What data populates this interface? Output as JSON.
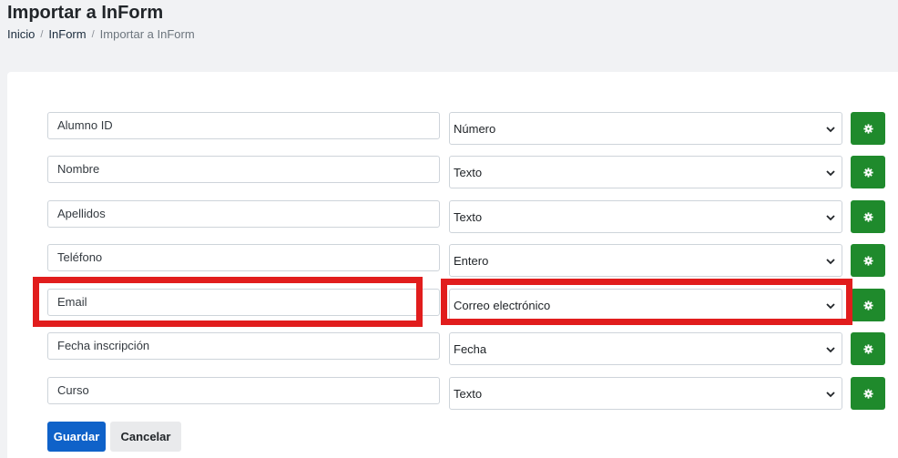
{
  "header": {
    "title": "Importar a InForm"
  },
  "breadcrumb": {
    "items": [
      "Inicio",
      "InForm",
      "Importar a InForm"
    ],
    "separator": "/"
  },
  "fields": [
    {
      "name": "Alumno ID",
      "type": "Número"
    },
    {
      "name": "Nombre",
      "type": "Texto"
    },
    {
      "name": "Apellidos",
      "type": "Texto"
    },
    {
      "name": "Teléfono",
      "type": "Entero"
    },
    {
      "name": "Email",
      "type": "Correo electrónico"
    },
    {
      "name": "Fecha inscripción",
      "type": "Fecha"
    },
    {
      "name": "Curso",
      "type": "Texto"
    }
  ],
  "highlighted_field": "Email",
  "actions": {
    "save_label": "Guardar",
    "cancel_label": "Cancelar"
  },
  "colors": {
    "primary": "#0f62c9",
    "settings_button": "#1f8a2c",
    "highlight": "#e11d1d"
  },
  "icons": {
    "settings": "gear-icon",
    "dropdown": "chevron-down-icon"
  }
}
